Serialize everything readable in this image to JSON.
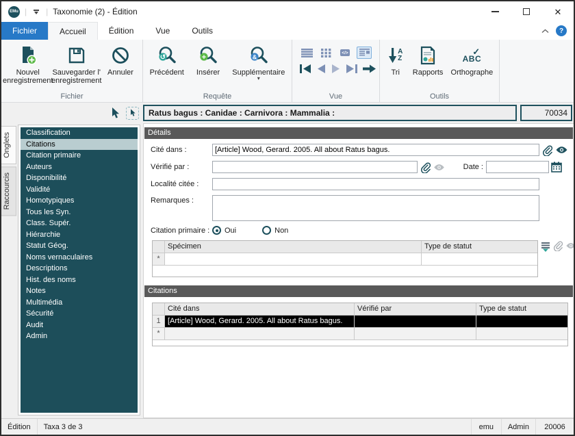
{
  "colors": {
    "accent_teal": "#1d505d",
    "sidebar_bg": "#1d4e5a",
    "sidebar_selected": "#b9cdd0",
    "file_tab_blue": "#2779c7",
    "green_plus": "#5cb948",
    "slate_icon": "#7d90b5",
    "section_header_gray": "#595959",
    "selected_row_black": "#000000"
  },
  "titlebar": {
    "logo": "EMu",
    "title": "Taxonomie (2) - Édition"
  },
  "tabs": {
    "items": [
      "Fichier",
      "Accueil",
      "Édition",
      "Vue",
      "Outils"
    ],
    "active": "Accueil"
  },
  "icons": {
    "help": "?",
    "sort_a": "A",
    "sort_z": "Z",
    "check": "✓",
    "abc": "ABC",
    "code": "</>",
    "refresh": "↺",
    "plus": "+",
    "amp": "&",
    "dropdown": "▾"
  },
  "ribbon": {
    "fichier": {
      "label": "Fichier",
      "new_record": "Nouvel enregistrement",
      "save_record": "Sauvegarder l' enregistrement",
      "cancel": "Annuler"
    },
    "requete": {
      "label": "Requête",
      "previous": "Précédent",
      "insert": "Insérer",
      "additional": "Supplémentaire"
    },
    "vue": {
      "label": "Vue"
    },
    "outils": {
      "label": "Outils",
      "sort": "Tri",
      "reports": "Rapports",
      "spelling": "Orthographe"
    }
  },
  "record": {
    "summary": "Ratus bagus : Canidae : Carnivora : Mammalia :",
    "number": "70034"
  },
  "sidebar": {
    "tabs": [
      "Onglets",
      "Raccourcis"
    ],
    "selected": "Citations",
    "items": [
      "Classification",
      "Citations",
      "Citation primaire",
      "Auteurs",
      "Disponibilité",
      "Validité",
      "Homotypiques",
      "Tous les Syn.",
      "Class. Supér.",
      "Hiérarchie",
      "Statut Géog.",
      "Noms vernaculaires",
      "Descriptions",
      "Hist. des noms",
      "Notes",
      "Multimédia",
      "Sécurité",
      "Audit",
      "Admin"
    ]
  },
  "details": {
    "header": "Détails",
    "cite_dans": {
      "label": "Cité dans :",
      "value": "[Article] Wood, Gerard. 2005. All about Ratus bagus."
    },
    "verifie_par": {
      "label": "Vérifié par :",
      "value": ""
    },
    "date_label": "Date :",
    "date_value": "",
    "localite": {
      "label": "Localité citée :",
      "value": ""
    },
    "remarques": {
      "label": "Remarques :",
      "value": ""
    },
    "citation_primaire": {
      "label": "Citation primaire :",
      "oui": "Oui",
      "non": "Non",
      "selected": "Oui"
    },
    "specimen_table": {
      "columns": [
        "Spécimen",
        "Type de statut"
      ],
      "new_row_marker": "*"
    }
  },
  "citations": {
    "header": "Citations",
    "columns": [
      "Cité dans",
      "Vérifié par",
      "Type de statut"
    ],
    "rows": [
      {
        "num": "1",
        "cite_dans": "[Article] Wood, Gerard. 2005. All about Ratus bagus.",
        "verifie_par": "",
        "type_statut": ""
      }
    ],
    "new_row_marker": "*"
  },
  "statusbar": {
    "left": [
      "Édition",
      "Taxa 3 de 3"
    ],
    "right": [
      "emu",
      "Admin",
      "20006"
    ]
  }
}
